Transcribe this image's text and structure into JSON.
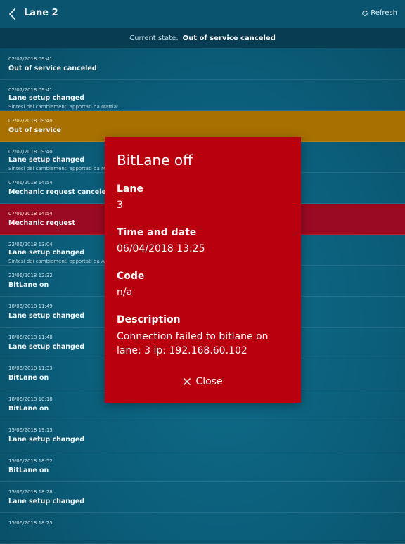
{
  "header": {
    "title": "Lane 2",
    "refresh_label": "Refresh"
  },
  "state": {
    "label": "Current state:",
    "value": "Out of service canceled"
  },
  "events": [
    {
      "date": "02/07/2018 09:41",
      "event": "Out of service canceled",
      "sub": "",
      "highlight": ""
    },
    {
      "date": "02/07/2018 09:41",
      "event": "Lane setup changed",
      "sub": "Sintesi dei cambiamenti apportati da Mattia:...",
      "highlight": ""
    },
    {
      "date": "02/07/2018 09:40",
      "event": "Out of service",
      "sub": "",
      "highlight": "orange"
    },
    {
      "date": "02/07/2018 09:40",
      "event": "Lane setup changed",
      "sub": "Sintesi dei cambiamenti apportati da Mattia",
      "highlight": ""
    },
    {
      "date": "07/06/2018 14:54",
      "event": "Mechanic request canceled",
      "sub": "",
      "highlight": ""
    },
    {
      "date": "07/06/2018 14:54",
      "event": "Mechanic request",
      "sub": "",
      "highlight": "red"
    },
    {
      "date": "22/06/2018 13:04",
      "event": "Lane setup changed",
      "sub": "Sintesi dei cambiamenti apportati da Admin",
      "highlight": ""
    },
    {
      "date": "22/06/2018 12:32",
      "event": "BitLane on",
      "sub": "",
      "highlight": ""
    },
    {
      "date": "18/06/2018 11:49",
      "event": "Lane setup changed",
      "sub": "",
      "highlight": ""
    },
    {
      "date": "18/06/2018 11:48",
      "event": "Lane setup changed",
      "sub": "",
      "highlight": ""
    },
    {
      "date": "18/06/2018 11:33",
      "event": "BitLane on",
      "sub": "",
      "highlight": ""
    },
    {
      "date": "18/06/2018 10:18",
      "event": "BitLane on",
      "sub": "",
      "highlight": ""
    },
    {
      "date": "15/06/2018 19:13",
      "event": "Lane setup changed",
      "sub": "",
      "highlight": ""
    },
    {
      "date": "15/06/2018 18:52",
      "event": "BitLane on",
      "sub": "",
      "highlight": ""
    },
    {
      "date": "15/06/2018 18:28",
      "event": "Lane setup changed",
      "sub": "",
      "highlight": ""
    },
    {
      "date": "15/06/2018 18:25",
      "event": "",
      "sub": "",
      "highlight": ""
    }
  ],
  "modal": {
    "title": "BitLane off",
    "lane_label": "Lane",
    "lane_value": "3",
    "time_label": "Time and date",
    "time_value": "06/04/2018 13:25",
    "code_label": "Code",
    "code_value": "n/a",
    "desc_label": "Description",
    "desc_value": "Connection failed to bitlane on lane: 3 ip: 192.168.60.102",
    "close_label": "Close",
    "background": "#b8000f"
  },
  "colors": {
    "accent_orange": "#a77000",
    "accent_red": "#9b0a23"
  }
}
